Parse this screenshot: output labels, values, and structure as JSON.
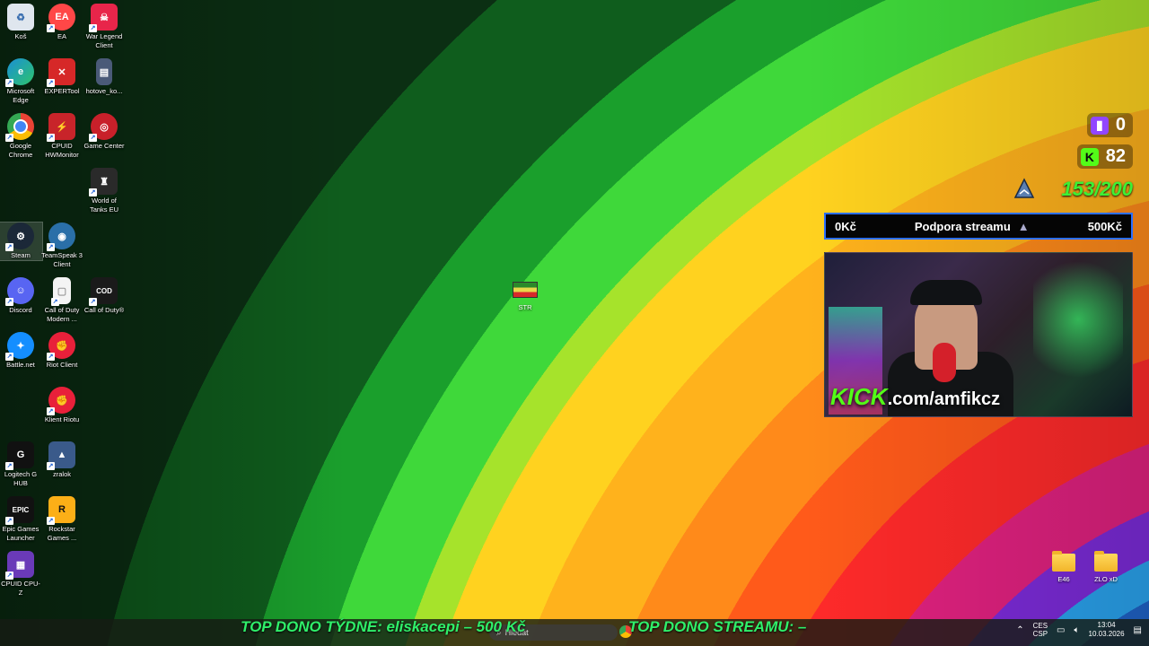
{
  "desktop_icons": [
    {
      "label": "Koš",
      "glyph": "♻",
      "color": "#dfe6ee"
    },
    {
      "label": "EA",
      "glyph": "EA",
      "color": "#ff4747"
    },
    {
      "label": "War Legend Client",
      "glyph": "☠",
      "color": "#e8254a"
    },
    {
      "label": "Microsoft Edge",
      "glyph": "e",
      "color": "#1a8fd6"
    },
    {
      "label": "EXPERTool",
      "glyph": "✕",
      "color": "#d62828"
    },
    {
      "label": "hotove_ko...",
      "glyph": "▤",
      "color": "#4a5a78"
    },
    {
      "label": "Google Chrome",
      "glyph": "●",
      "color": "#ea4335"
    },
    {
      "label": "CPUID HWMonitor",
      "glyph": "⚡",
      "color": "#c8242a"
    },
    {
      "label": "Game Center",
      "glyph": "◎",
      "color": "#c8202a"
    },
    {
      "label": "World of Tanks EU",
      "glyph": "♜",
      "color": "#2a2a2a"
    },
    {
      "label": "Steam",
      "glyph": "⚙",
      "color": "#1b2838"
    },
    {
      "label": "TeamSpeak 3 Client",
      "glyph": "◉",
      "color": "#2a6fa8"
    },
    {
      "label": "Discord",
      "glyph": "☺",
      "color": "#5865f2"
    },
    {
      "label": "Call of Duty Modern ...",
      "glyph": "▢",
      "color": "#f4f4f4"
    },
    {
      "label": "Call of Duty®",
      "glyph": "COD",
      "color": "#1a1a1a"
    },
    {
      "label": "Battle.net",
      "glyph": "✦",
      "color": "#148eff"
    },
    {
      "label": "Riot Client",
      "glyph": "✊",
      "color": "#e8203a"
    },
    {
      "label": "Klient Riotu",
      "glyph": "✊",
      "color": "#e8203a"
    },
    {
      "label": "Logitech G HUB",
      "glyph": "G",
      "color": "#111111"
    },
    {
      "label": "zralok",
      "glyph": "▲",
      "color": "#3a5a8a"
    },
    {
      "label": "Epic Games Launcher",
      "glyph": "EPIC",
      "color": "#111111"
    },
    {
      "label": "Rockstar Games ...",
      "glyph": "R",
      "color": "#fcaf17"
    },
    {
      "label": "CPUID CPU-Z",
      "glyph": "▦",
      "color": "#6a3ab8"
    }
  ],
  "flag_item": {
    "label": "STR"
  },
  "folders": [
    {
      "label": "E46"
    },
    {
      "label": "ZLO xD"
    }
  ],
  "overlay": {
    "twitch_count": "0",
    "kick_count": "82",
    "goal": "153/200",
    "donate_left": "0Kč",
    "donate_title": "Podpora streamu",
    "donate_right": "500Kč",
    "kick_brand": "KICK",
    "kick_url": ".com/amfikcz"
  },
  "ticker": {
    "week": "TOP DONO TÝDNE:  eliskacepi – 500 Kč",
    "stream": "TOP DONO STREAMU: –"
  },
  "taskbar": {
    "search_placeholder": "Hledat",
    "lang_top": "CES",
    "lang_bottom": "CSP",
    "time": "13:04",
    "date": "10.03.2026"
  }
}
